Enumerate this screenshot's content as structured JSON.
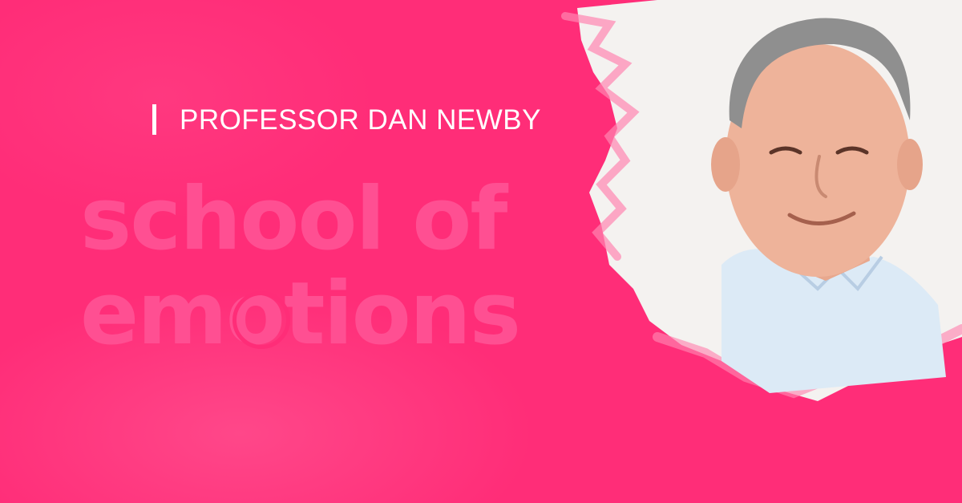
{
  "speaker": {
    "name": "PROFESSOR DAN NEWBY"
  },
  "watermark": {
    "line1": "school of",
    "line2_pre": "em",
    "line2_o": "o",
    "line2_post": "tions"
  },
  "colors": {
    "background": "#ff2d78",
    "watermark": "#ff4f92",
    "text": "#ffffff"
  },
  "icons": {
    "watermark_ring": "ring-logo-icon"
  }
}
